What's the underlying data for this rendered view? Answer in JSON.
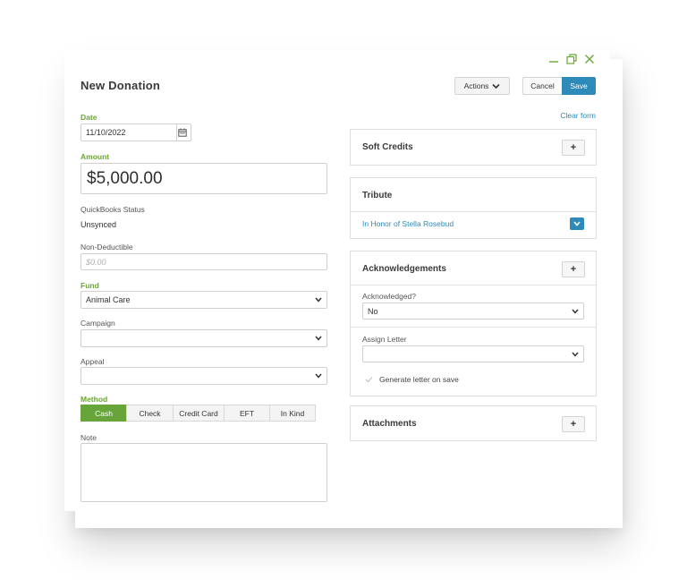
{
  "window": {
    "minimize_icon": "minimize-icon",
    "restore_icon": "restore-icon",
    "close_icon": "close-icon",
    "accent": "#6aa633"
  },
  "header": {
    "title": "New Donation",
    "actions_label": "Actions",
    "cancel_label": "Cancel",
    "save_label": "Save",
    "clear_form_label": "Clear form",
    "save_color": "#2e8ab8"
  },
  "form": {
    "date_label": "Date",
    "date_value": "11/10/2022",
    "amount_label": "Amount",
    "amount_value": "$5,000.00",
    "qb_status_label": "QuickBooks Status",
    "qb_status_value": "Unsynced",
    "non_deductible_label": "Non-Deductible",
    "non_deductible_placeholder": "$0.00",
    "fund_label": "Fund",
    "fund_value": "Animal Care",
    "campaign_label": "Campaign",
    "campaign_value": "",
    "appeal_label": "Appeal",
    "appeal_value": "",
    "method_label": "Method",
    "methods": [
      "Cash",
      "Check",
      "Credit Card",
      "EFT",
      "In Kind"
    ],
    "method_selected": "Cash",
    "note_label": "Note"
  },
  "side": {
    "soft_credits_title": "Soft Credits",
    "tribute_title": "Tribute",
    "tribute_value": "In Honor of Stella Rosebud",
    "ack_title": "Acknowledgements",
    "acknowledged_label": "Acknowledged?",
    "acknowledged_value": "No",
    "assign_letter_label": "Assign Letter",
    "assign_letter_value": "",
    "generate_letter_label": "Generate letter on save",
    "attachments_title": "Attachments",
    "plus_symbol": "+"
  }
}
